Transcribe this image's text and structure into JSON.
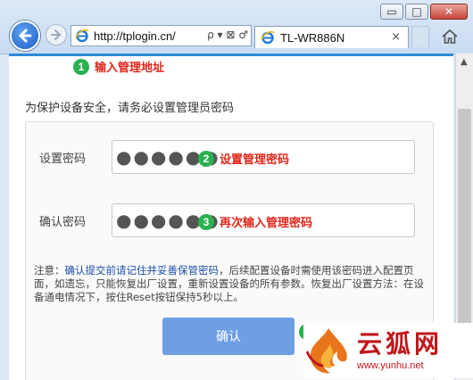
{
  "browser": {
    "address_url": "http://tplogin.cn/",
    "address_tools": "ρ ▾ ⊠ ♂",
    "tab_title": "TL-WR886N",
    "tab_close": "×",
    "window_min": "▭",
    "window_max": "□",
    "window_close": "✕"
  },
  "annotations": {
    "step1": {
      "number": "1",
      "text": "输入管理地址"
    },
    "step2": {
      "number": "2",
      "text": "设置管理密码"
    },
    "step3": {
      "number": "3",
      "text": "再次输入管理密码"
    }
  },
  "form": {
    "intro": "为保护设备安全，请务必设置管理员密码",
    "set_password_label": "设置密码",
    "set_password_value": "●●●●●●",
    "confirm_password_label": "确认密码",
    "confirm_password_value": "●●●●●●",
    "note_prefix": "注意：",
    "note_highlight": "确认提交前请记住并妥善保管密码",
    "note_rest": "，后续配置设备时需使用该密码进入配置页面，如遗忘，只能恢复出厂设置，重新设置设备的所有参数。恢复出厂设置方法：在设备通电情况下，按住Reset按钮保持5秒以上。",
    "confirm_button": "确认"
  },
  "watermark": {
    "title": "云狐网",
    "url": "www.yunhu.net"
  },
  "colors": {
    "accent_blue": "#2d8ad6",
    "button_blue": "#6e9fe3",
    "annotation_red": "#e0261b",
    "badge_green": "#2ab150",
    "watermark_red": "#c0151a"
  }
}
